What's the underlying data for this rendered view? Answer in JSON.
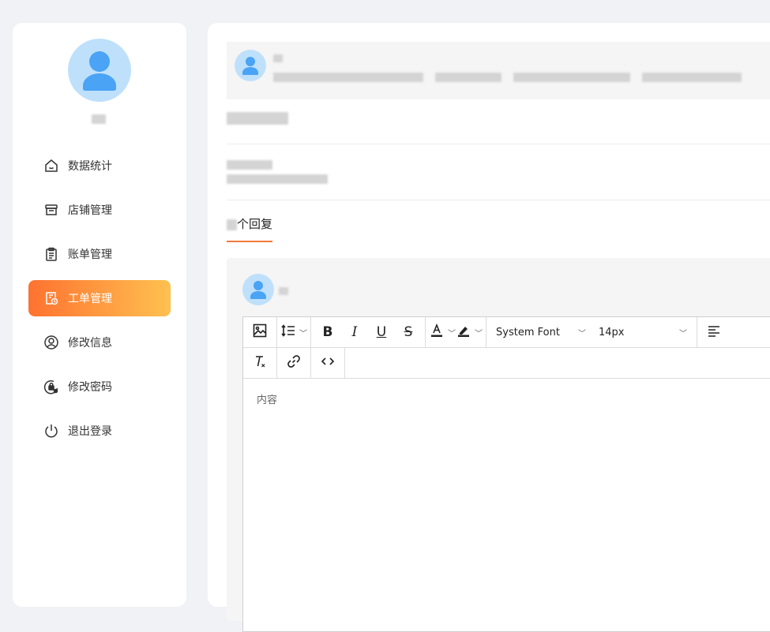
{
  "sidebar": {
    "menu": [
      {
        "label": "数据统计",
        "icon": "home-icon",
        "active": false
      },
      {
        "label": "店铺管理",
        "icon": "store-icon",
        "active": false
      },
      {
        "label": "账单管理",
        "icon": "bill-icon",
        "active": false
      },
      {
        "label": "工单管理",
        "icon": "ticket-icon",
        "active": true
      },
      {
        "label": "修改信息",
        "icon": "user-circle-icon",
        "active": false
      },
      {
        "label": "修改密码",
        "icon": "lock-gear-icon",
        "active": false
      },
      {
        "label": "退出登录",
        "icon": "power-icon",
        "active": false
      }
    ]
  },
  "replies": {
    "count_suffix": "个回复"
  },
  "editor": {
    "font_family": "System Font",
    "font_size": "14px",
    "placeholder": "内容"
  },
  "colors": {
    "accent_start": "#ff7230",
    "accent_end": "#ffc150",
    "avatar_bg": "#bfe0fb",
    "avatar_fg": "#4aa3f5"
  }
}
